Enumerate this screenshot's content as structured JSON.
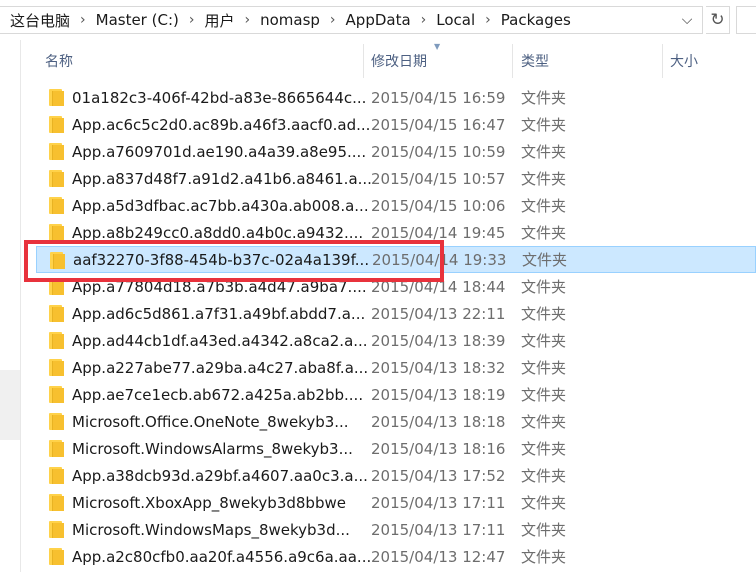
{
  "address": {
    "crumbs": [
      "这台电脑",
      "Master (C:)",
      "用户",
      "nomasp",
      "AppData",
      "Local",
      "Packages"
    ],
    "separator": "›",
    "dropdown_icon": "chevron-down-icon",
    "refresh_icon": "refresh-icon"
  },
  "columns": {
    "name": "名称",
    "date": "修改日期",
    "type": "类型",
    "size": "大小"
  },
  "colors": {
    "selection": "#cce8ff",
    "highlight": "#e8323c",
    "folder": "#ffd24a"
  },
  "files": [
    {
      "name": "01a182c3-406f-42bd-a83e-8665644c...",
      "date": "2015/04/15 16:59",
      "type": "文件夹"
    },
    {
      "name": "App.ac6c5c2d0.ac89b.a46f3.aacf0.ad...",
      "date": "2015/04/15 16:47",
      "type": "文件夹"
    },
    {
      "name": "App.a7609701d.ae190.a4a39.a8e95....",
      "date": "2015/04/15 10:59",
      "type": "文件夹"
    },
    {
      "name": "App.a837d48f7.a91d2.a41b6.a8461.a...",
      "date": "2015/04/15 10:57",
      "type": "文件夹"
    },
    {
      "name": "App.a5d3dfbac.ac7bb.a430a.ab008.a...",
      "date": "2015/04/15 10:06",
      "type": "文件夹"
    },
    {
      "name": "App.a8b249cc0.a8dd0.a4b0c.a9432....",
      "date": "2015/04/14 19:45",
      "type": "文件夹"
    },
    {
      "name": "aaf32270-3f88-454b-b37c-02a4a139f...",
      "date": "2015/04/14 19:33",
      "type": "文件夹",
      "selected": true
    },
    {
      "name": "App.a77804d18.a7b3b.a4d47.a9ba7....",
      "date": "2015/04/14 18:44",
      "type": "文件夹"
    },
    {
      "name": "App.ad6c5d861.a7f31.a49bf.abdd7.a...",
      "date": "2015/04/13 22:11",
      "type": "文件夹"
    },
    {
      "name": "App.ad44cb1df.a43ed.a4342.a8ca2.a...",
      "date": "2015/04/13 18:39",
      "type": "文件夹"
    },
    {
      "name": "App.a227abe77.a29ba.a4c27.aba8f.a...",
      "date": "2015/04/13 18:32",
      "type": "文件夹"
    },
    {
      "name": "App.ae7ce1ecb.ab672.a425a.ab2bb....",
      "date": "2015/04/13 18:19",
      "type": "文件夹"
    },
    {
      "name": "Microsoft.Office.OneNote_8wekyb3...",
      "date": "2015/04/13 18:18",
      "type": "文件夹"
    },
    {
      "name": "Microsoft.WindowsAlarms_8wekyb3...",
      "date": "2015/04/13 18:16",
      "type": "文件夹"
    },
    {
      "name": "App.a38dcb93d.a29bf.a4607.aa0c3.a...",
      "date": "2015/04/13 17:52",
      "type": "文件夹"
    },
    {
      "name": "Microsoft.XboxApp_8wekyb3d8bbwe",
      "date": "2015/04/13 17:11",
      "type": "文件夹"
    },
    {
      "name": "Microsoft.WindowsMaps_8wekyb3d...",
      "date": "2015/04/13 17:11",
      "type": "文件夹"
    },
    {
      "name": "App.a2c80cfb0.aa20f.a4556.a9c6a.aa...",
      "date": "2015/04/13 12:47",
      "type": "文件夹"
    }
  ]
}
